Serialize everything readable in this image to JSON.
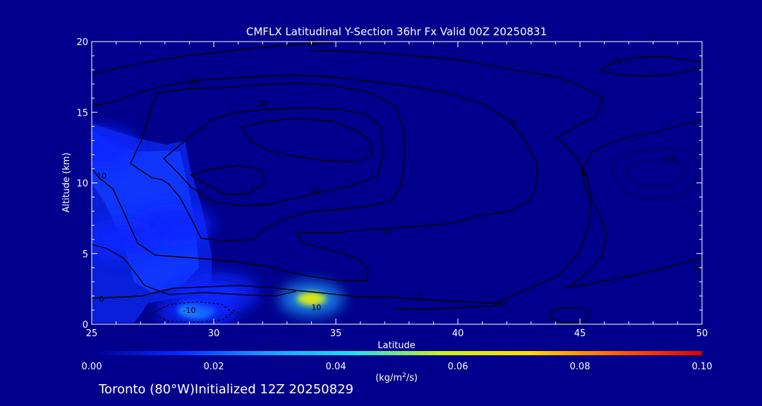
{
  "chart_data": {
    "type": "heatmap",
    "title": "CMFLX Latitudinal Y-Section 36hr  Fx Valid 00Z 20250831",
    "xlabel": "Latitude",
    "ylabel": "Altitude (km)",
    "xlim": [
      25,
      50
    ],
    "ylim": [
      0,
      20
    ],
    "x_ticks": [
      25,
      30,
      35,
      40,
      45,
      50
    ],
    "y_ticks": [
      0,
      5,
      10,
      15,
      20
    ],
    "colorbar": {
      "min": 0.0,
      "max": 0.1,
      "ticks": [
        "0.00",
        "0.02",
        "0.04",
        "0.06",
        "0.08",
        "0.10"
      ],
      "colors": [
        "#000090",
        "#0a28ff",
        "#1e9bff",
        "#23dcf0",
        "#c8f01e",
        "#ffdc00",
        "#ff6400",
        "#dc0000"
      ]
    },
    "contour_labels": [
      {
        "text": "10",
        "lat": 34.2,
        "alt": 1.2,
        "dashed": false
      },
      {
        "text": "-10",
        "lat": 29.0,
        "alt": 1.0,
        "dashed": true
      },
      {
        "text": "0",
        "lat": 25.4,
        "alt": 1.8,
        "dashed": false
      },
      {
        "text": "0",
        "lat": 38.4,
        "alt": 1.9,
        "dashed": false
      },
      {
        "text": "10",
        "lat": 25.4,
        "alt": 10.5,
        "dashed": false
      },
      {
        "text": "10",
        "lat": 29.2,
        "alt": 17.2,
        "dashed": false
      },
      {
        "text": "10",
        "lat": 37.1,
        "alt": 6.6,
        "dashed": false
      },
      {
        "text": "10",
        "lat": 34.0,
        "alt": 19.9,
        "dashed": false
      },
      {
        "text": "20",
        "lat": 32.0,
        "alt": 15.6,
        "dashed": false
      },
      {
        "text": "20",
        "lat": 34.2,
        "alt": 9.4,
        "dashed": false
      },
      {
        "text": "0",
        "lat": 42.3,
        "alt": 14.3,
        "dashed": false
      },
      {
        "text": "0",
        "lat": 45.1,
        "alt": 10.7,
        "dashed": false
      },
      {
        "text": "0",
        "lat": 49.8,
        "alt": 4.0,
        "dashed": false
      },
      {
        "text": "0",
        "lat": 46.6,
        "alt": 18.6,
        "dashed": false
      },
      {
        "text": "-10",
        "lat": 48.7,
        "alt": 11.7,
        "dashed": true
      }
    ],
    "flux_blobs": [
      {
        "lat": 34.0,
        "alt": 1.8,
        "value": 0.055
      },
      {
        "lat": 29.3,
        "alt": 1.0,
        "value": 0.035
      },
      {
        "lat": 25.3,
        "alt": 12.5,
        "value": 0.02
      },
      {
        "lat": 28.3,
        "alt": 7.0,
        "value": 0.018
      },
      {
        "lat": 26.2,
        "alt": 6.0,
        "value": 0.015
      },
      {
        "lat": 30.2,
        "alt": 2.2,
        "value": 0.018
      }
    ]
  },
  "footer": {
    "text": "Toronto (80°W)Initialized 12Z 20250829"
  }
}
